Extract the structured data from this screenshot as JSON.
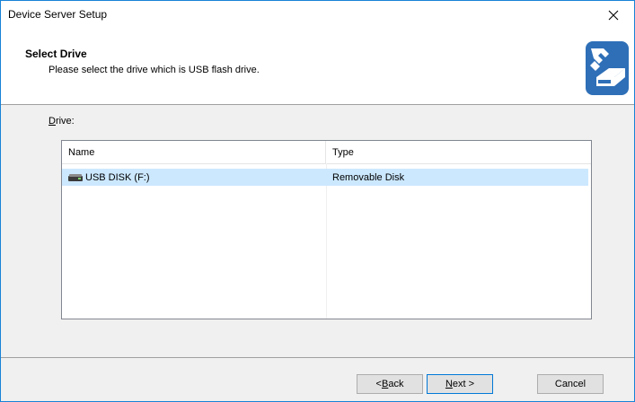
{
  "window": {
    "title": "Device Server Setup",
    "close_glyph": "×"
  },
  "header": {
    "title": "Select Drive",
    "subtitle": "Please select the drive which is USB flash drive.",
    "icon": "usb-drive-wrench-icon"
  },
  "drive_label": {
    "mnemonic": "D",
    "rest": "rive:"
  },
  "listview": {
    "columns": [
      "Name",
      "Type"
    ],
    "rows": [
      {
        "name": "USB DISK (F:)",
        "type": "Removable Disk",
        "selected": true,
        "icon": "removable-disk-icon"
      }
    ]
  },
  "buttons": {
    "back": {
      "prefix": "< ",
      "mnemonic": "B",
      "rest": "ack"
    },
    "next": {
      "mnemonic": "N",
      "rest": "ext >"
    },
    "cancel": "Cancel"
  },
  "colors": {
    "accent": "#1883d7",
    "selection": "#cce8ff",
    "icon_blue": "#2e6fb7"
  }
}
